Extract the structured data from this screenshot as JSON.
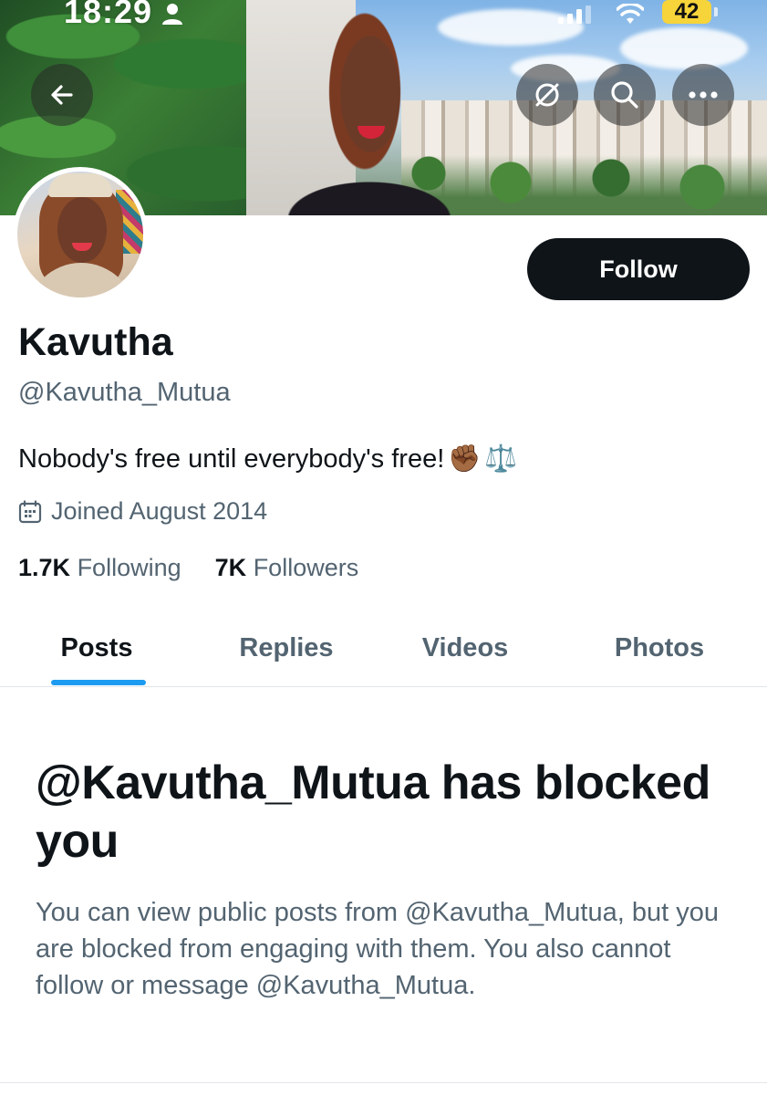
{
  "status_bar": {
    "time": "18:29",
    "battery": "42",
    "accent_battery": "#f6d43a"
  },
  "header": {
    "back_icon": "arrow-left-icon",
    "grok_icon": "grok-icon",
    "search_icon": "search-icon",
    "more_icon": "more-horizontal-icon"
  },
  "profile": {
    "display_name": "Kavutha",
    "handle": "@Kavutha_Mutua",
    "bio": "Nobody's free until everybody's free!",
    "bio_emoji_1": "✊🏾",
    "bio_emoji_2": "⚖️",
    "joined": "Joined August 2014",
    "following_count": "1.7K",
    "following_label": "Following",
    "followers_count": "7K",
    "followers_label": "Followers",
    "follow_button": "Follow"
  },
  "tabs": [
    {
      "label": "Posts",
      "active": true
    },
    {
      "label": "Replies",
      "active": false
    },
    {
      "label": "Videos",
      "active": false
    },
    {
      "label": "Photos",
      "active": false
    }
  ],
  "blocked": {
    "title": "@Kavutha_Mutua has blocked you",
    "description": "You can view public posts from @Kavutha_Mutua, but you are blocked from engaging with them. You also cannot follow or message @Kavutha_Mutua."
  },
  "colors": {
    "text_primary": "#0f1419",
    "text_secondary": "#536471",
    "accent_blue": "#1d9bf0",
    "follow_button_bg": "#0f1419"
  }
}
